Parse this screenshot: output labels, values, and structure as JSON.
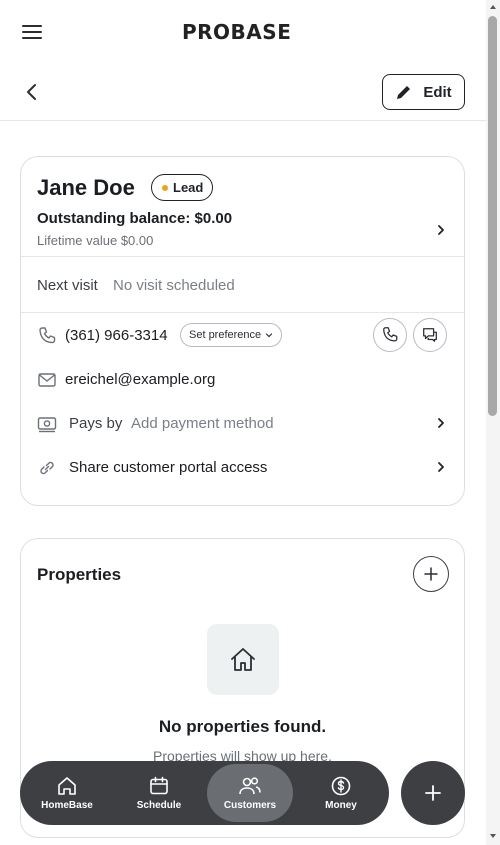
{
  "app": {
    "logo": "PROBASE"
  },
  "header": {
    "edit_label": "Edit"
  },
  "customer": {
    "name": "Jane Doe",
    "status": "Lead",
    "status_color": "#f0a020",
    "balance": "Outstanding balance: $0.00",
    "lifetime": "Lifetime value $0.00",
    "next_visit_label": "Next visit",
    "next_visit_value": "No visit scheduled",
    "phone": "(361) 966-3314",
    "pref_label": "Set preference",
    "email": "ereichel@example.org",
    "pays_by_label": "Pays by",
    "pays_by_value": "Add payment method",
    "share_label": "Share customer portal access"
  },
  "properties": {
    "title": "Properties",
    "empty_title": "No properties found.",
    "empty_sub": "Properties will show up here."
  },
  "nav": {
    "items": [
      {
        "label": "HomeBase",
        "icon": "home-icon"
      },
      {
        "label": "Schedule",
        "icon": "calendar-icon"
      },
      {
        "label": "Customers",
        "icon": "users-icon",
        "active": true
      },
      {
        "label": "Money",
        "icon": "dollar-icon"
      }
    ]
  },
  "colors": {
    "nav_bg": "#3d3f43",
    "nav_active": "#6a6d71",
    "accent_dot": "#f0a020"
  }
}
